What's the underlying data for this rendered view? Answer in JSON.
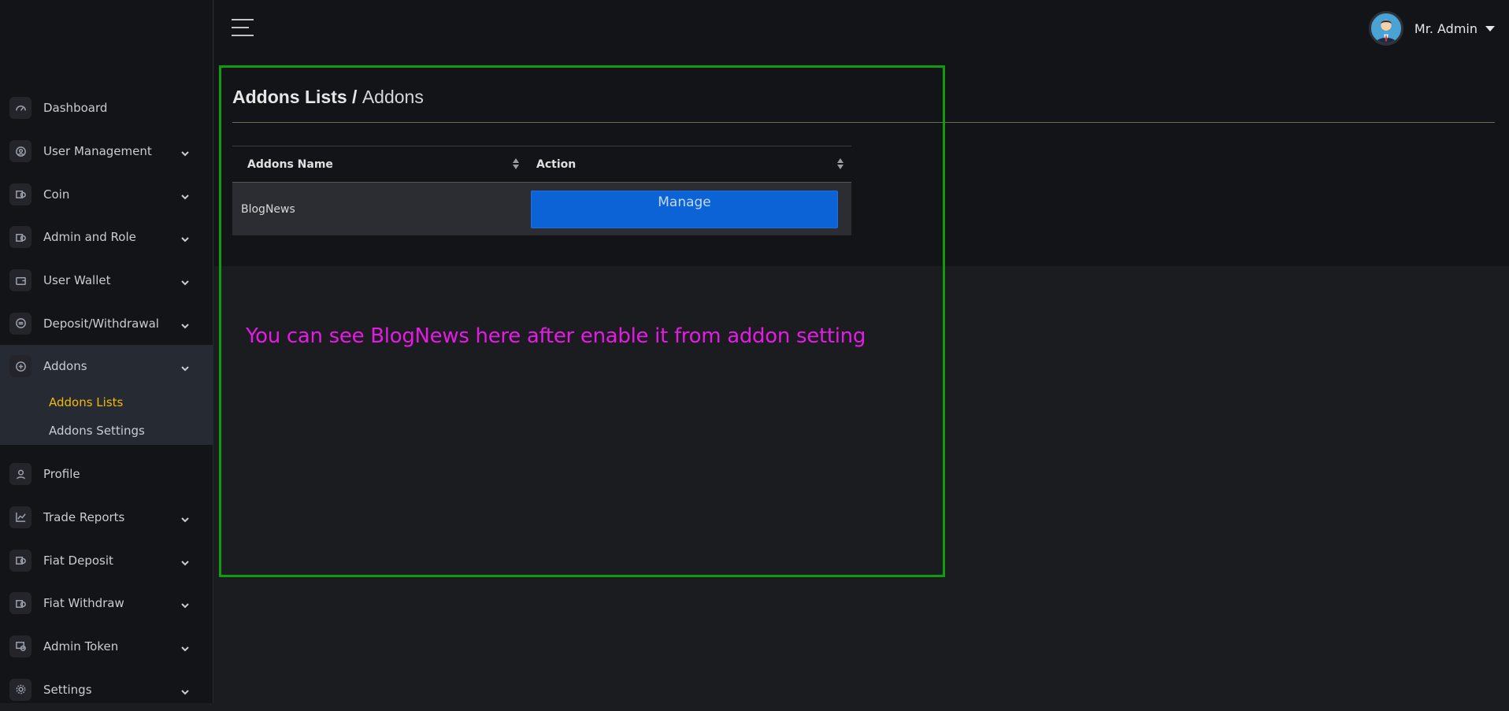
{
  "topbar": {
    "user_name": "Mr. Admin"
  },
  "sidebar": {
    "items": [
      {
        "label": "Dashboard",
        "icon": "dashboard-icon",
        "has_chevron": false
      },
      {
        "label": "User Management",
        "icon": "user-circle-icon",
        "has_chevron": true
      },
      {
        "label": "Coin",
        "icon": "coin-icon",
        "has_chevron": true
      },
      {
        "label": "Admin and Role",
        "icon": "coin-icon",
        "has_chevron": true
      },
      {
        "label": "User Wallet",
        "icon": "wallet-icon",
        "has_chevron": true
      },
      {
        "label": "Deposit/Withdrawal",
        "icon": "exchange-icon",
        "has_chevron": true
      }
    ],
    "addons": {
      "label": "Addons",
      "icon": "addons-icon",
      "sub_items": [
        {
          "label": "Addons Lists",
          "active": true
        },
        {
          "label": "Addons Settings",
          "active": false
        }
      ]
    },
    "items_after": [
      {
        "label": "Profile",
        "icon": "user-icon",
        "has_chevron": false
      },
      {
        "label": "Trade Reports",
        "icon": "chart-line-icon",
        "has_chevron": true
      },
      {
        "label": "Fiat Deposit",
        "icon": "coin-icon",
        "has_chevron": true
      },
      {
        "label": "Fiat Withdraw",
        "icon": "coin-icon",
        "has_chevron": true
      },
      {
        "label": "Admin Token",
        "icon": "token-icon",
        "has_chevron": true
      },
      {
        "label": "Settings",
        "icon": "gear-icon",
        "has_chevron": true
      }
    ]
  },
  "page": {
    "title": "Addons Lists /",
    "crumb": "Addons"
  },
  "table": {
    "columns": [
      "Addons Name",
      "Action"
    ],
    "rows": [
      {
        "name": "BlogNews",
        "action": "Manage"
      }
    ]
  },
  "annotation": {
    "note": "You can see BlogNews here after enable it from addon setting",
    "box_color": "#0f9d0f",
    "note_color": "#e51be5"
  },
  "colors": {
    "accent_active": "#f0b90b",
    "button": "#0c63d6"
  }
}
